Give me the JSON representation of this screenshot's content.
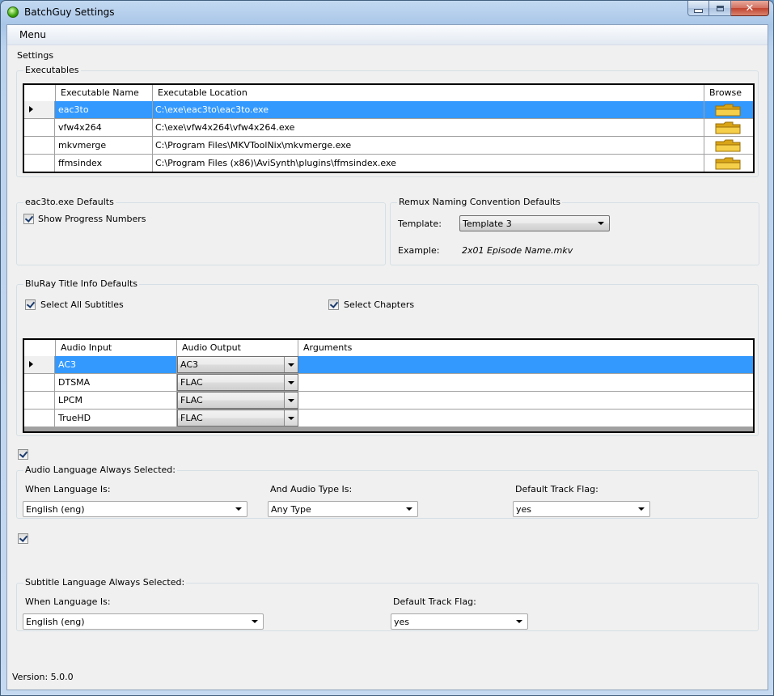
{
  "window": {
    "title": "BatchGuy Settings",
    "close_glyph": "✕"
  },
  "menu": {
    "label": "Menu"
  },
  "settings_label": "Settings",
  "executables": {
    "group_title": "Executables",
    "columns": [
      "Executable Name",
      "Executable Location",
      "Browse"
    ],
    "rows": [
      {
        "name": "eac3to",
        "location": "C:\\exe\\eac3to\\eac3to.exe",
        "selected": true
      },
      {
        "name": "vfw4x264",
        "location": "C:\\exe\\vfw4x264\\vfw4x264.exe",
        "selected": false
      },
      {
        "name": "mkvmerge",
        "location": "C:\\Program Files\\MKVToolNix\\mkvmerge.exe",
        "selected": false
      },
      {
        "name": "ffmsindex",
        "location": "C:\\Program Files (x86)\\AviSynth\\plugins\\ffmsindex.exe",
        "selected": false
      }
    ],
    "browse_icon": "folder-icon"
  },
  "eac3to_defaults": {
    "group_title": "eac3to.exe Defaults",
    "show_progress_label": "Show Progress Numbers",
    "show_progress_checked": true
  },
  "remux": {
    "group_title": "Remux Naming Convention Defaults",
    "template_label": "Template:",
    "template_value": "Template 3",
    "example_label": "Example:",
    "example_value": "2x01 Episode Name.mkv"
  },
  "bluray": {
    "group_title": "BluRay Title Info Defaults",
    "select_all_subtitles_label": "Select All Subtitles",
    "select_all_subtitles_checked": true,
    "select_chapters_label": "Select Chapters",
    "select_chapters_checked": true,
    "columns": [
      "Audio Input",
      "Audio Output",
      "Arguments"
    ],
    "rows": [
      {
        "input": "AC3",
        "output": "AC3",
        "arguments": "",
        "selected": true
      },
      {
        "input": "DTSMA",
        "output": "FLAC",
        "arguments": "",
        "selected": false
      },
      {
        "input": "LPCM",
        "output": "FLAC",
        "arguments": "",
        "selected": false
      },
      {
        "input": "TrueHD",
        "output": "FLAC",
        "arguments": "",
        "selected": false
      }
    ]
  },
  "audio_language": {
    "enabled_checked": true,
    "group_title": "Audio Language Always Selected:",
    "when_language_label": "When Language Is:",
    "when_language_value": "English (eng)",
    "audio_type_label": "And Audio Type Is:",
    "audio_type_value": "Any Type",
    "default_track_label": "Default Track Flag:",
    "default_track_value": "yes"
  },
  "subtitle_language": {
    "enabled_checked": true,
    "group_title": "Subtitle Language Always Selected:",
    "when_language_label": "When Language Is:",
    "when_language_value": "English (eng)",
    "default_track_label": "Default Track Flag:",
    "default_track_value": "yes"
  },
  "footer": {
    "version": "Version: 5.0.0"
  },
  "colors": {
    "selection": "#3399ff",
    "window_frame": "#bcd3ee",
    "client_bg": "#f0f0f0"
  }
}
